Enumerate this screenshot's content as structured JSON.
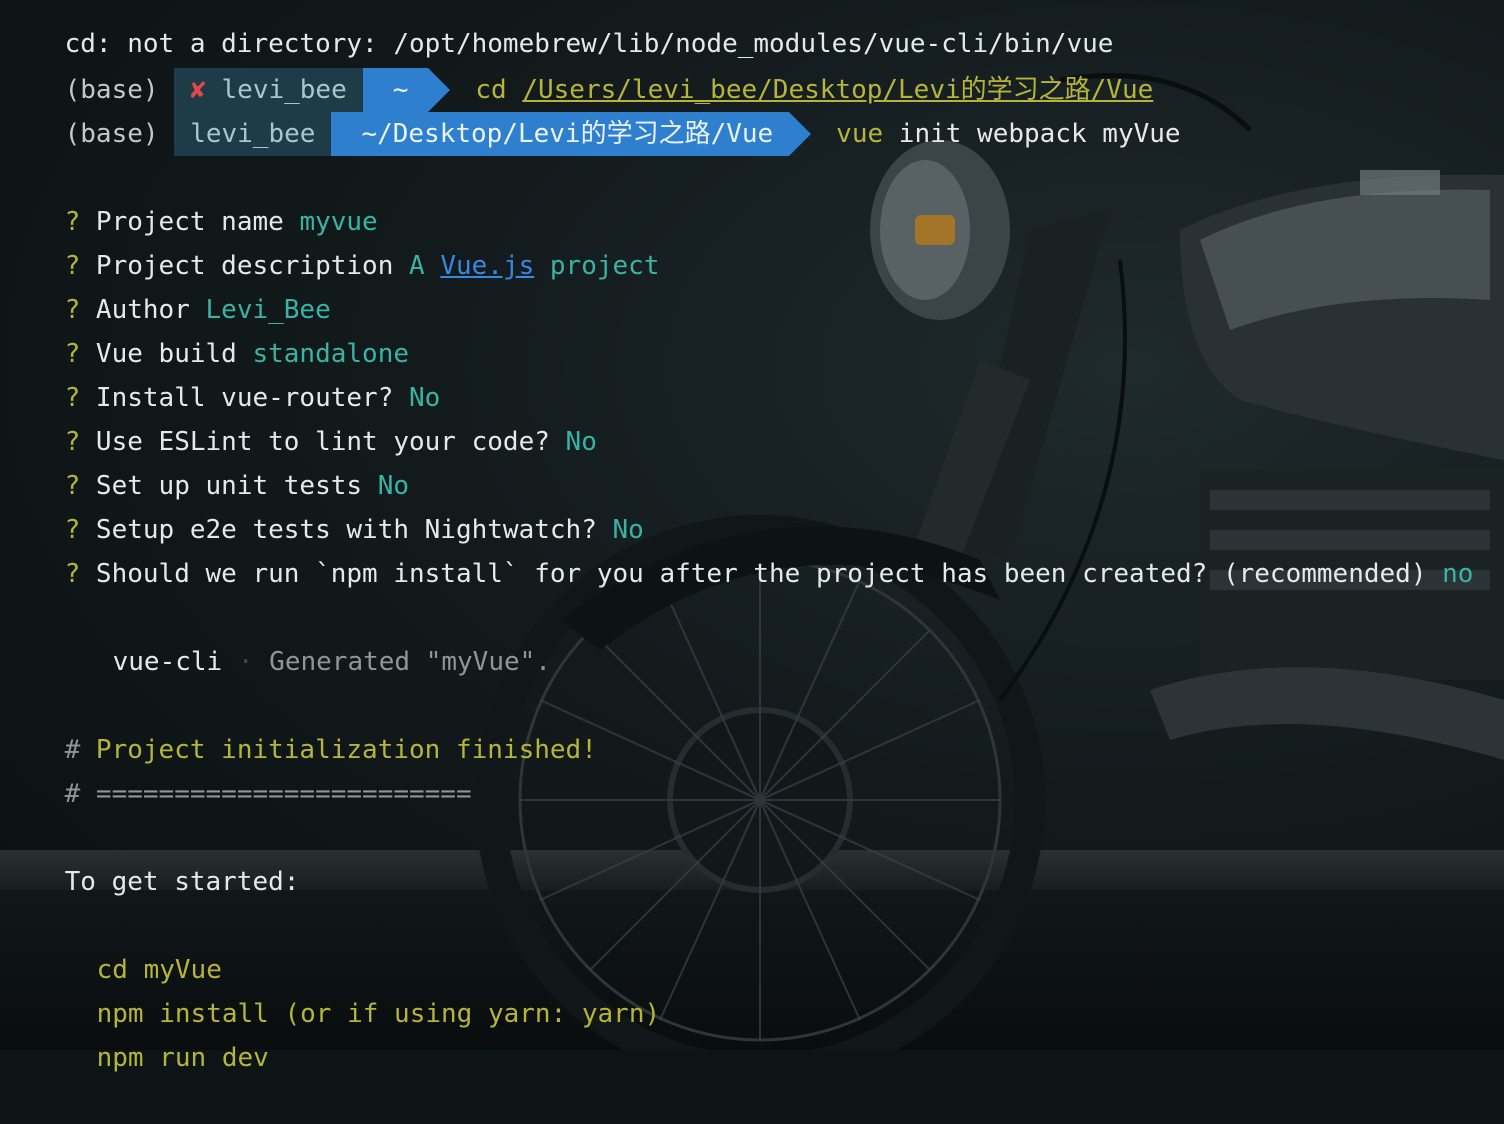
{
  "terminal": {
    "lines": {
      "error": "cd: not a directory: /opt/homebrew/lib/node_modules/vue-cli/bin/vue",
      "prompt1": {
        "env": "(base)",
        "status_icon": "✘",
        "user": "levi_bee",
        "dir": "~",
        "cmd": "cd",
        "arg": "/Users/levi_bee/Desktop/Levi的学习之路/Vue"
      },
      "prompt2": {
        "env": "(base)",
        "user": "levi_bee",
        "dir": "~/Desktop/Levi的学习之路/Vue",
        "cmd": "vue",
        "args": " init webpack myVue"
      },
      "questions": [
        {
          "mark": "?",
          "q": " Project name ",
          "a": "myvue"
        },
        {
          "mark": "?",
          "q": " Project description ",
          "a_pre": "A ",
          "a_link": "Vue.js",
          "a_post": " project"
        },
        {
          "mark": "?",
          "q": " Author ",
          "a": "Levi_Bee"
        },
        {
          "mark": "?",
          "q": " Vue build ",
          "a": "standalone"
        },
        {
          "mark": "?",
          "q": " Install vue-router? ",
          "a": "No"
        },
        {
          "mark": "?",
          "q": " Use ESLint to lint your code? ",
          "a": "No"
        },
        {
          "mark": "?",
          "q": " Set up unit tests ",
          "a": "No"
        },
        {
          "mark": "?",
          "q": " Setup e2e tests with Nightwatch? ",
          "a": "No"
        },
        {
          "mark": "?",
          "q": " Should we run `npm install` for you after the project has been created? (recommended) ",
          "a": "no"
        }
      ],
      "generated": {
        "tool": "vue-cli",
        "sep": "·",
        "msg": "Generated \"myVue\"."
      },
      "finished": {
        "hash": "#",
        "text": " Project initialization finished!"
      },
      "rule": {
        "hash": "#",
        "text": " ========================"
      },
      "started": "To get started:",
      "steps": [
        "cd myVue",
        "npm install (or if using yarn: yarn)",
        "npm run dev"
      ]
    }
  },
  "colors": {
    "accent_yellow": "#b6b43a",
    "answer_teal": "#3ab3a4",
    "segment_dark": "#1d3c48",
    "segment_blue": "#2f7fcf",
    "error_red": "#e04848"
  }
}
